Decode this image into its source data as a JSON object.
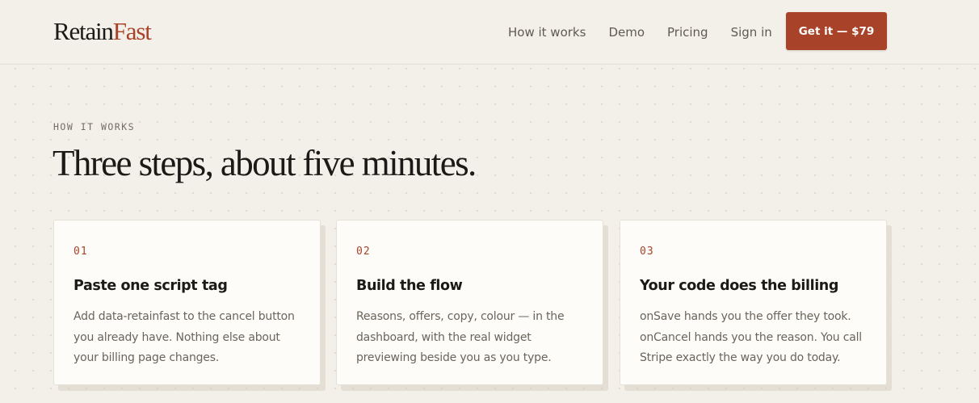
{
  "brand": {
    "logo_main": "Retain",
    "logo_accent": "Fast"
  },
  "nav": {
    "links": [
      {
        "label": "How it works"
      },
      {
        "label": "Demo"
      },
      {
        "label": "Pricing"
      },
      {
        "label": "Sign in"
      }
    ],
    "cta_label": "Get it — $79"
  },
  "section": {
    "eyebrow": "HOW IT WORKS",
    "title": "Three steps, about five minutes."
  },
  "steps": [
    {
      "number": "01",
      "title": "Paste one script tag",
      "description": "Add data-retainfast to the cancel button you already have. Nothing else about your billing page changes."
    },
    {
      "number": "02",
      "title": "Build the flow",
      "description": "Reasons, offers, copy, colour — in the dashboard, with the real widget previewing beside you as you type."
    },
    {
      "number": "03",
      "title": "Your code does the billing",
      "description": "onSave hands you the offer they took. onCancel hands you the reason. You call Stripe exactly the way you do today."
    }
  ],
  "colors": {
    "accent": "#a84228",
    "background": "#f3f0ea",
    "card": "#fdfcf9",
    "text": "#1c1a17",
    "muted": "#6a645c"
  }
}
